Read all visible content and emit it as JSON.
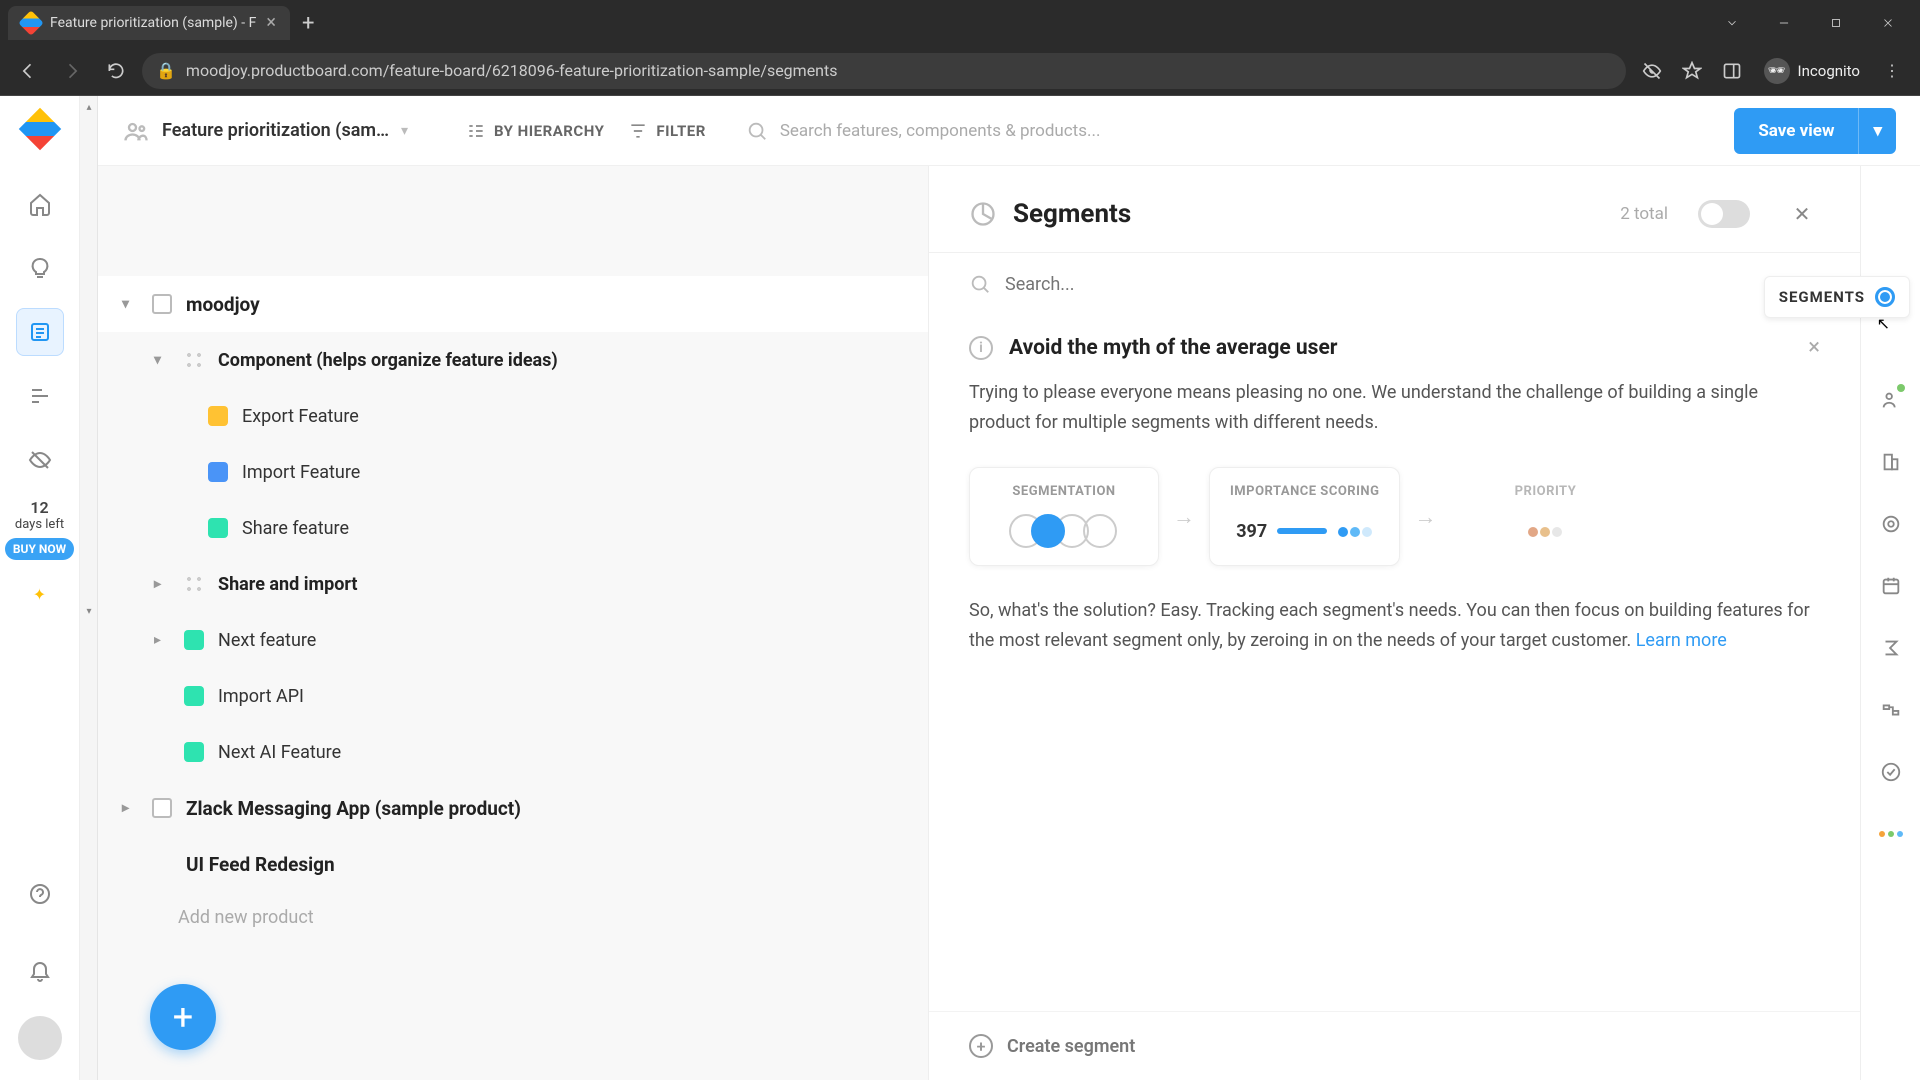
{
  "browser": {
    "tab_title": "Feature prioritization (sample) - F",
    "url": "moodjoy.productboard.com/feature-board/6218096-feature-prioritization-sample/segments",
    "incognito_label": "Incognito"
  },
  "topbar": {
    "board_name": "Feature prioritization (sam…",
    "hierarchy_label": "BY HIERARCHY",
    "filter_label": "FILTER",
    "search_placeholder": "Search features, components & products...",
    "save_label": "Save view"
  },
  "left_rail": {
    "trial_number": "12",
    "trial_unit": "days left",
    "buy_label": "BUY NOW"
  },
  "tree": {
    "root": "moodjoy",
    "component_group": "Component (helps organize feature ideas)",
    "features": {
      "export": "Export Feature",
      "import": "Import Feature",
      "share": "Share feature"
    },
    "share_import_group": "Share and import",
    "next_feature": "Next feature",
    "import_api": "Import API",
    "next_ai": "Next AI Feature",
    "zlack": "Zlack Messaging App (sample product)",
    "ui_feed": "UI Feed Redesign",
    "add_product": "Add new product"
  },
  "panel": {
    "title": "Segments",
    "total": "2 total",
    "search_placeholder": "Search...",
    "tip_title": "Avoid the myth of the average user",
    "tip_body_1": "Trying to please everyone means pleasing no one. We understand the challenge of building a single product for multiple segments with different needs.",
    "tip_body_2": "So, what's the solution? Easy. Tracking each segment's needs. You can then focus on building features for the most relevant segment only, by zeroing in on the needs of your target customer. ",
    "learn_more": "Learn more",
    "card_seg": "SEGMENTATION",
    "card_imp": "IMPORTANCE SCORING",
    "card_imp_value": "397",
    "card_pri": "PRIORITY",
    "create_label": "Create segment"
  },
  "right_rail": {
    "segments_label": "SEGMENTS"
  }
}
